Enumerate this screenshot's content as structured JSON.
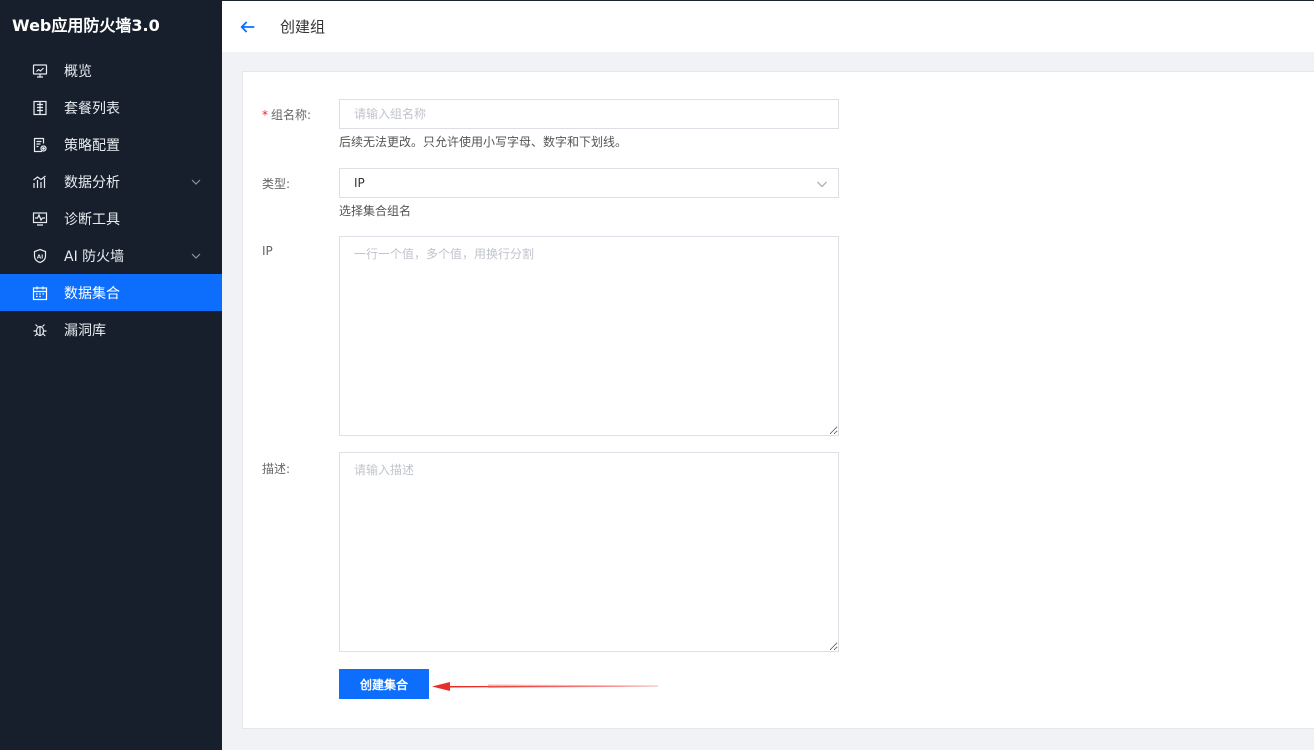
{
  "app": {
    "title": "Web应用防火墙3.0"
  },
  "sidebar": {
    "items": [
      {
        "label": "概览",
        "icon": "monitor-icon",
        "active": false
      },
      {
        "label": "套餐列表",
        "icon": "list-icon",
        "active": false
      },
      {
        "label": "策略配置",
        "icon": "policy-icon",
        "active": false
      },
      {
        "label": "数据分析",
        "icon": "chart-icon",
        "active": false,
        "expandable": true
      },
      {
        "label": "诊断工具",
        "icon": "diagnose-icon",
        "active": false
      },
      {
        "label": "AI 防火墙",
        "icon": "ai-shield-icon",
        "active": false,
        "expandable": true
      },
      {
        "label": "数据集合",
        "icon": "calendar-icon",
        "active": true
      },
      {
        "label": "漏洞库",
        "icon": "bug-icon",
        "active": false
      }
    ]
  },
  "header": {
    "title": "创建组"
  },
  "form": {
    "group_name": {
      "required_mark": "*",
      "label": "组名称:",
      "placeholder": "请输入组名称",
      "value": "",
      "hint": "后续无法更改。只允许使用小写字母、数字和下划线。"
    },
    "type": {
      "label": "类型:",
      "value": "IP",
      "hint": "选择集合组名"
    },
    "ip": {
      "label": "IP",
      "placeholder": "一行一个值，多个值，用换行分割"
    },
    "description": {
      "label": "描述:",
      "placeholder": "请输入描述"
    },
    "submit_label": "创建集合"
  },
  "colors": {
    "sidebar_bg": "#161f2b",
    "accent": "#0d6efd",
    "required": "#f5222d",
    "annotation": "#e8231f"
  }
}
